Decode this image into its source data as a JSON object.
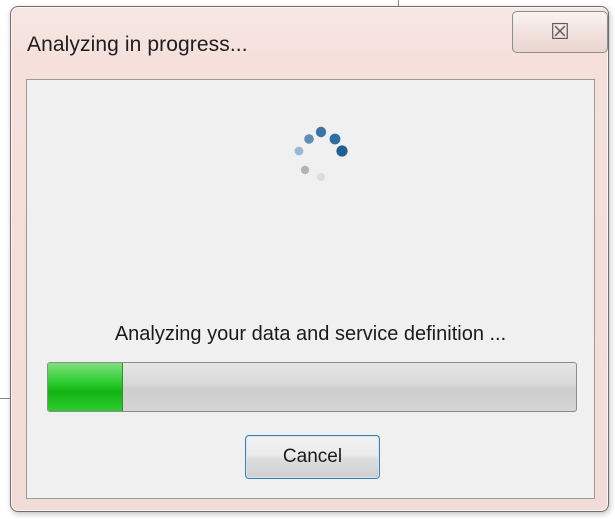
{
  "dialog": {
    "title": "Analyzing in progress...",
    "close_icon": "close-icon",
    "close_glyph": "☒",
    "status_text": "Analyzing your data and service definition ...",
    "progress_fraction": 0.14,
    "cancel_label": "Cancel"
  },
  "colors": {
    "progress_green": "#13b313",
    "spinner_blue": "#2d6ea3",
    "button_focus_border": "#3c7fb1"
  }
}
